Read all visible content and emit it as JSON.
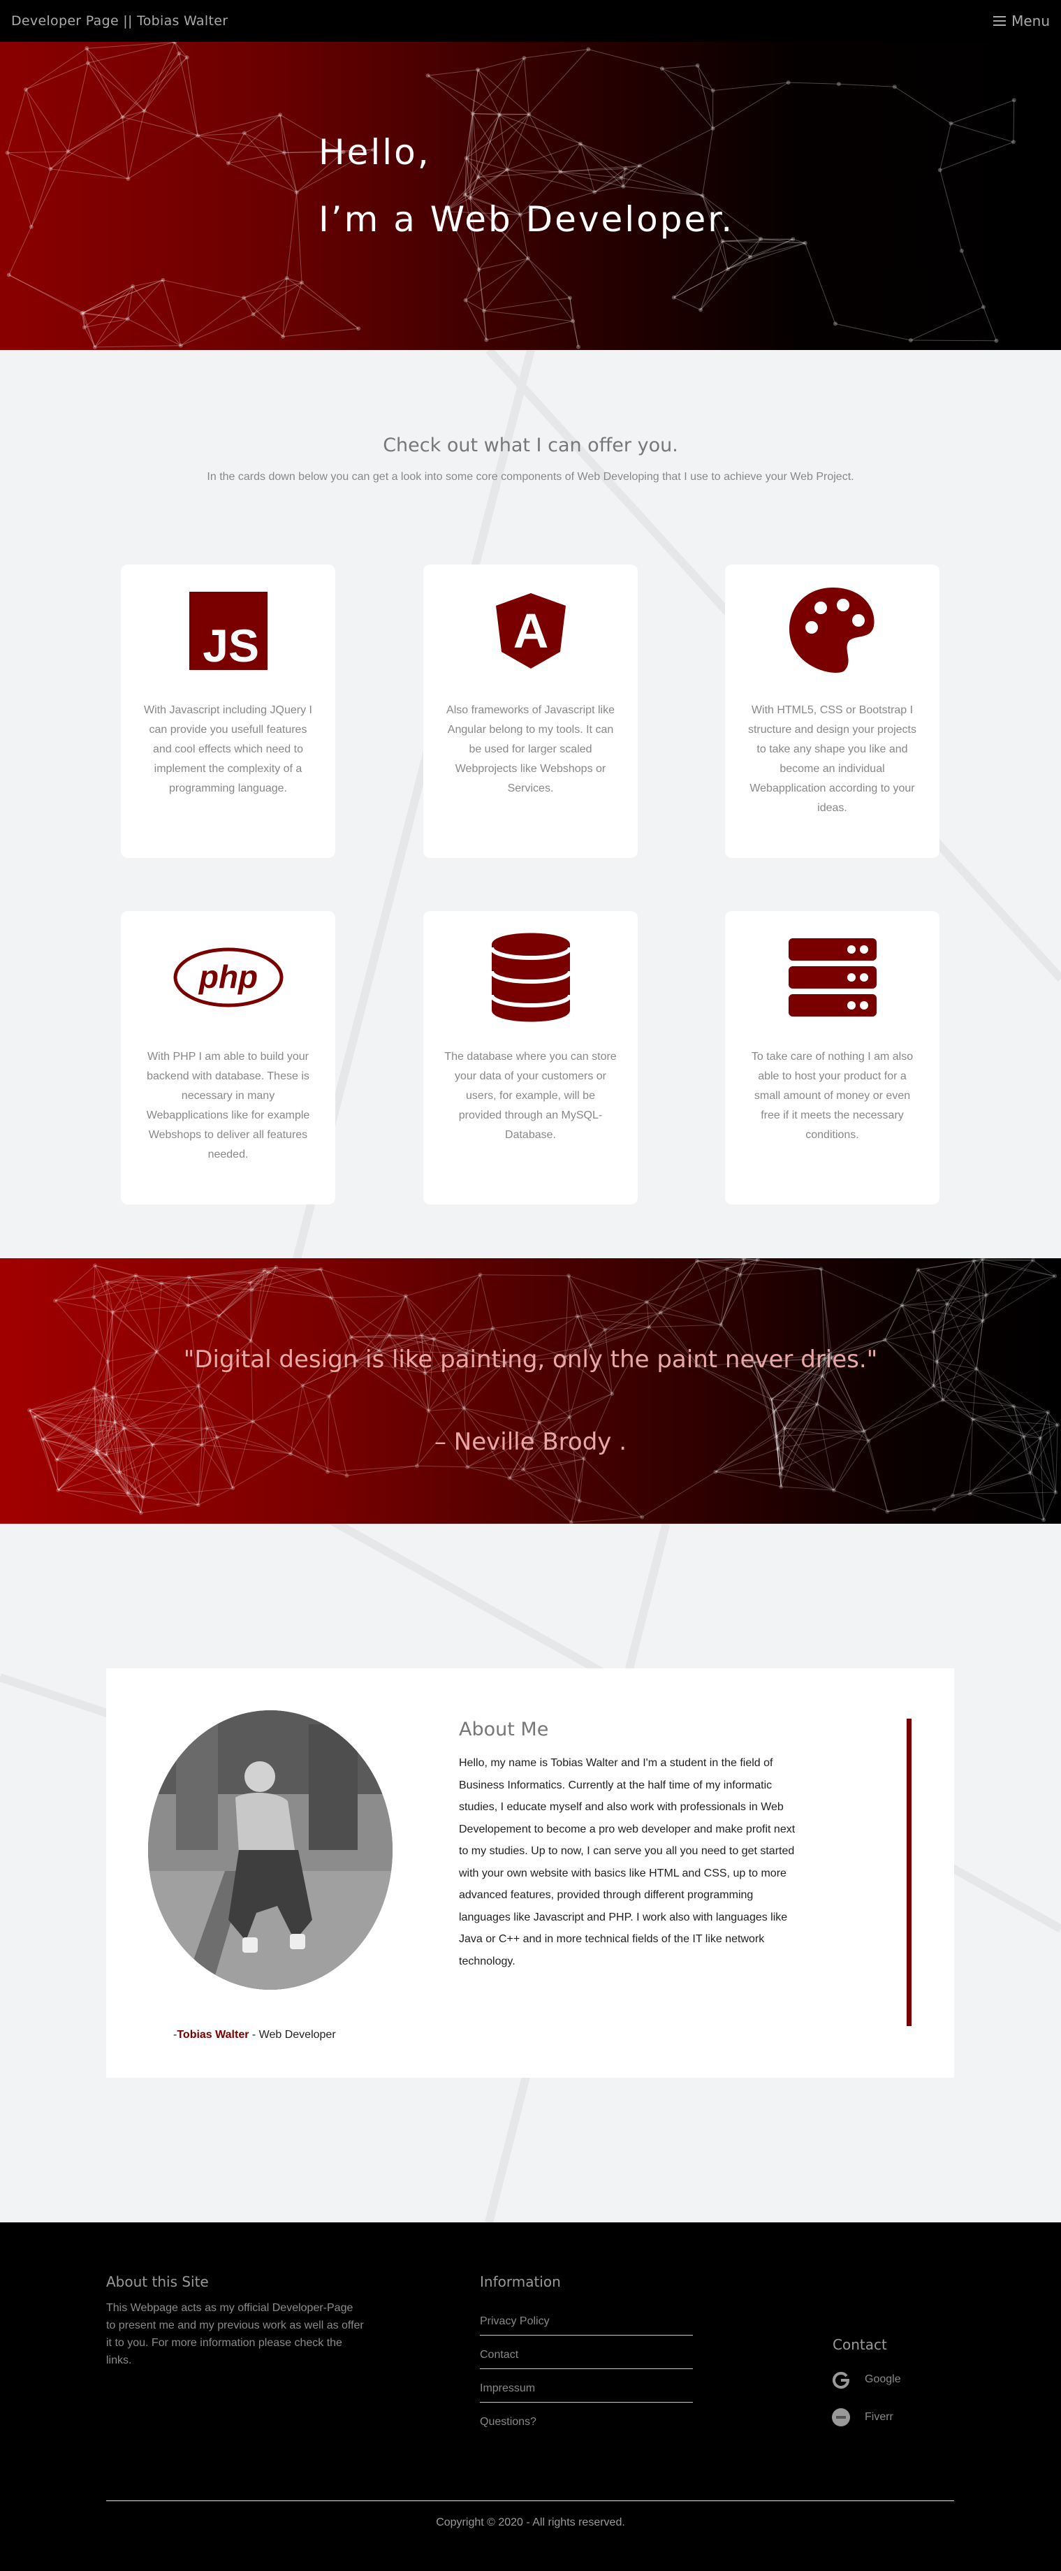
{
  "navbar": {
    "brand": "Developer Page || Tobias Walter",
    "menu_label": "Menu"
  },
  "hero": {
    "line1": "Hello,",
    "line2": "I’m a Web Developer."
  },
  "services": {
    "title": "Check out what I can offer you.",
    "subtitle": "In the cards down below you can get a look into some core components of Web Developing that I use to achieve your Web Project.",
    "cards": [
      {
        "icon": "javascript-icon",
        "icon_text": "JS",
        "text": "With Javascript including JQuery I can provide you usefull features and cool effects which need to implement the complexity of a programming language."
      },
      {
        "icon": "angular-icon",
        "icon_text": "A",
        "text": "Also frameworks of Javascript like Angular belong to my tools. It can be used for larger scaled Webprojects like Webshops or Services."
      },
      {
        "icon": "palette-icon",
        "text": "With HTML5, CSS or Bootstrap I structure and design your projects to take any shape you like and become an individual Webapplication according to your ideas."
      },
      {
        "icon": "php-icon",
        "icon_text": "php",
        "text": "With PHP I am able to build your backend with database. These is necessary in many Webapplications like for example Webshops to deliver all features needed."
      },
      {
        "icon": "database-icon",
        "text": "The database where you can store your data of your customers or users, for example, will be provided through an MySQL-Database."
      },
      {
        "icon": "server-icon",
        "text": "To take care of nothing I am also able to host your product for a small amount of money or even free if it meets the necessary conditions."
      }
    ]
  },
  "quote": {
    "text": "\"Digital design is like painting, only the paint never dries.\"",
    "author": "– Neville Brody ."
  },
  "about": {
    "title": "About Me",
    "text": "Hello, my name is Tobias Walter and I'm a student in the field of Business Informatics. Currently at the half time of my informatic studies, I educate myself and also work with professionals in Web Developement to become a pro web developer and make profit next to my studies. Up to now, I can serve you all you need to get started with your own website with basics like HTML and CSS, up to more advanced features, provided through different programming languages like Javascript and PHP. I work also with languages like Java or C++ and in more technical fields of the IT like network technology.",
    "caption_prefix": "-",
    "caption_name": "Tobias Walter",
    "caption_role": " - Web Developer"
  },
  "footer": {
    "about_title": "About this Site",
    "about_text": "This Webpage acts as my official Developer-Page to present me and my previous work as well as offer it to you. For more information please check the links.",
    "info_title": "Information",
    "links": [
      "Privacy Policy",
      "Contact",
      "Impressum",
      "Questions?"
    ],
    "contact_title": "Contact",
    "contacts": [
      {
        "label": "Google",
        "icon": "google-icon"
      },
      {
        "label": "Fiverr",
        "icon": "fiverr-icon"
      }
    ],
    "copyright": "Copyright © 2020 - All rights reserved."
  },
  "colors": {
    "accent": "#7a0000",
    "hero_red": "#8a0000",
    "footer_bg": "#000000",
    "page_bg": "#f2f3f4"
  }
}
